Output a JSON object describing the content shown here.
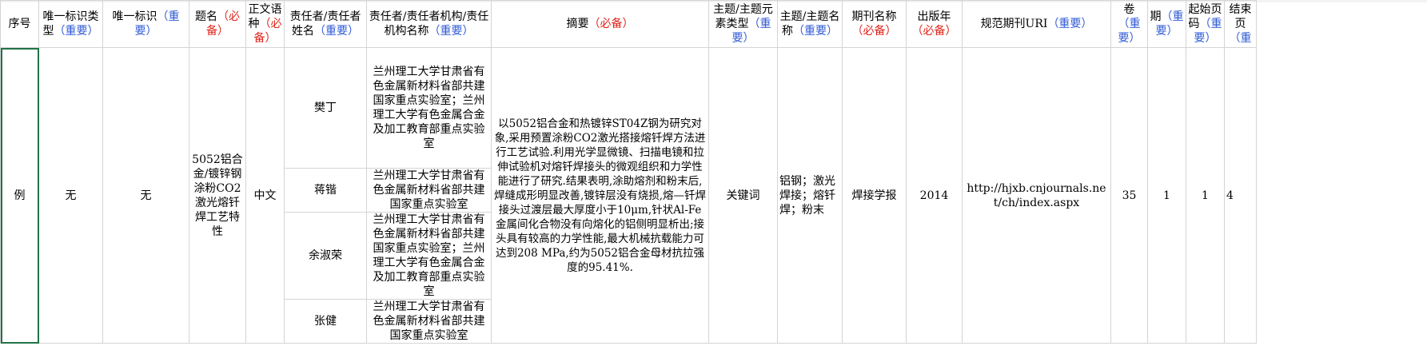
{
  "headers": [
    {
      "main": "序号"
    },
    {
      "main": "唯一标识类型",
      "note": "（重要）",
      "note_color": "blue"
    },
    {
      "main": "唯一标识",
      "note": "（重要）",
      "note_color": "blue"
    },
    {
      "main": "题名",
      "note": "（必备）",
      "note_color": "red"
    },
    {
      "main": "正文语种",
      "note": "（必备）",
      "note_color": "red"
    },
    {
      "main": "责任者/责任者姓名",
      "note": "（重要）",
      "note_color": "blue"
    },
    {
      "main": "责任者/责任者机构/责任机构名称",
      "note": "（重要）",
      "note_color": "blue"
    },
    {
      "main": "摘要",
      "note": "（必备）",
      "note_color": "red"
    },
    {
      "main": "主题/主题元素类型",
      "note": "（重要）",
      "note_color": "blue"
    },
    {
      "main": "主题/主题名称",
      "note": "（重要）",
      "note_color": "blue"
    },
    {
      "main": "期刊名称",
      "note": "（必备）",
      "note_color": "red"
    },
    {
      "main": "出版年",
      "note": "（必备）",
      "note_color": "red"
    },
    {
      "main": "规范期刊URI",
      "note": "（重要）",
      "note_color": "blue"
    },
    {
      "main": "卷",
      "note": "（重要）",
      "note_color": "blue"
    },
    {
      "main": "期",
      "note": "（重要）",
      "note_color": "blue"
    },
    {
      "main": "起始页码",
      "note": "（重要）",
      "note_color": "blue"
    },
    {
      "main": "结束页",
      "note": "（重",
      "note_color": "blue"
    }
  ],
  "row": {
    "seq": "例",
    "id_type": "无",
    "id": "无",
    "title": "5052铝合金/镀锌钢涂粉CO2激光熔钎焊工艺特性",
    "language": "中文",
    "authors": [
      {
        "name": "樊丁",
        "org": "兰州理工大学甘肃省有色金属新材料省部共建国家重点实验室；兰州理工大学有色金属合金及加工教育部重点实验室"
      },
      {
        "name": "蒋锴",
        "org": "兰州理工大学甘肃省有色金属新材料省部共建国家重点实验室"
      },
      {
        "name": "余淑荣",
        "org": "兰州理工大学甘肃省有色金属新材料省部共建国家重点实验室；兰州理工大学有色金属合金及加工教育部重点实验室"
      },
      {
        "name": "张健",
        "org": "兰州理工大学甘肃省有色金属新材料省部共建国家重点实验室"
      }
    ],
    "abstract": "以5052铝合金和热镀锌ST04Z钢为研究对象,采用预置涂粉CO2激光搭接熔钎焊方法进行工艺试验.利用光学显微镜、扫描电镜和拉伸试验机对熔钎焊接头的微观组织和力学性能进行了研究.结果表明,涂助熔剂和粉末后,焊缝成形明显改善,镀锌层没有烧损,熔—钎焊接头过渡层最大厚度小于10μm,针状Al-Fe金属间化合物没有向熔化的铝侧明显析出;接头具有较高的力学性能,最大机械抗载能力可达到208 MPa,约为5052铝合金母材抗拉强度的95.41%.",
    "subject_type": "关键词",
    "subject_name": "铝钢；激光焊接；熔钎焊；粉末",
    "journal": "焊接学报",
    "year": "2014",
    "uri": "http://hjxb.cnjournals.net/ch/index.aspx",
    "volume": "35",
    "issue": "1",
    "start_page": "1",
    "end_page": "4"
  }
}
